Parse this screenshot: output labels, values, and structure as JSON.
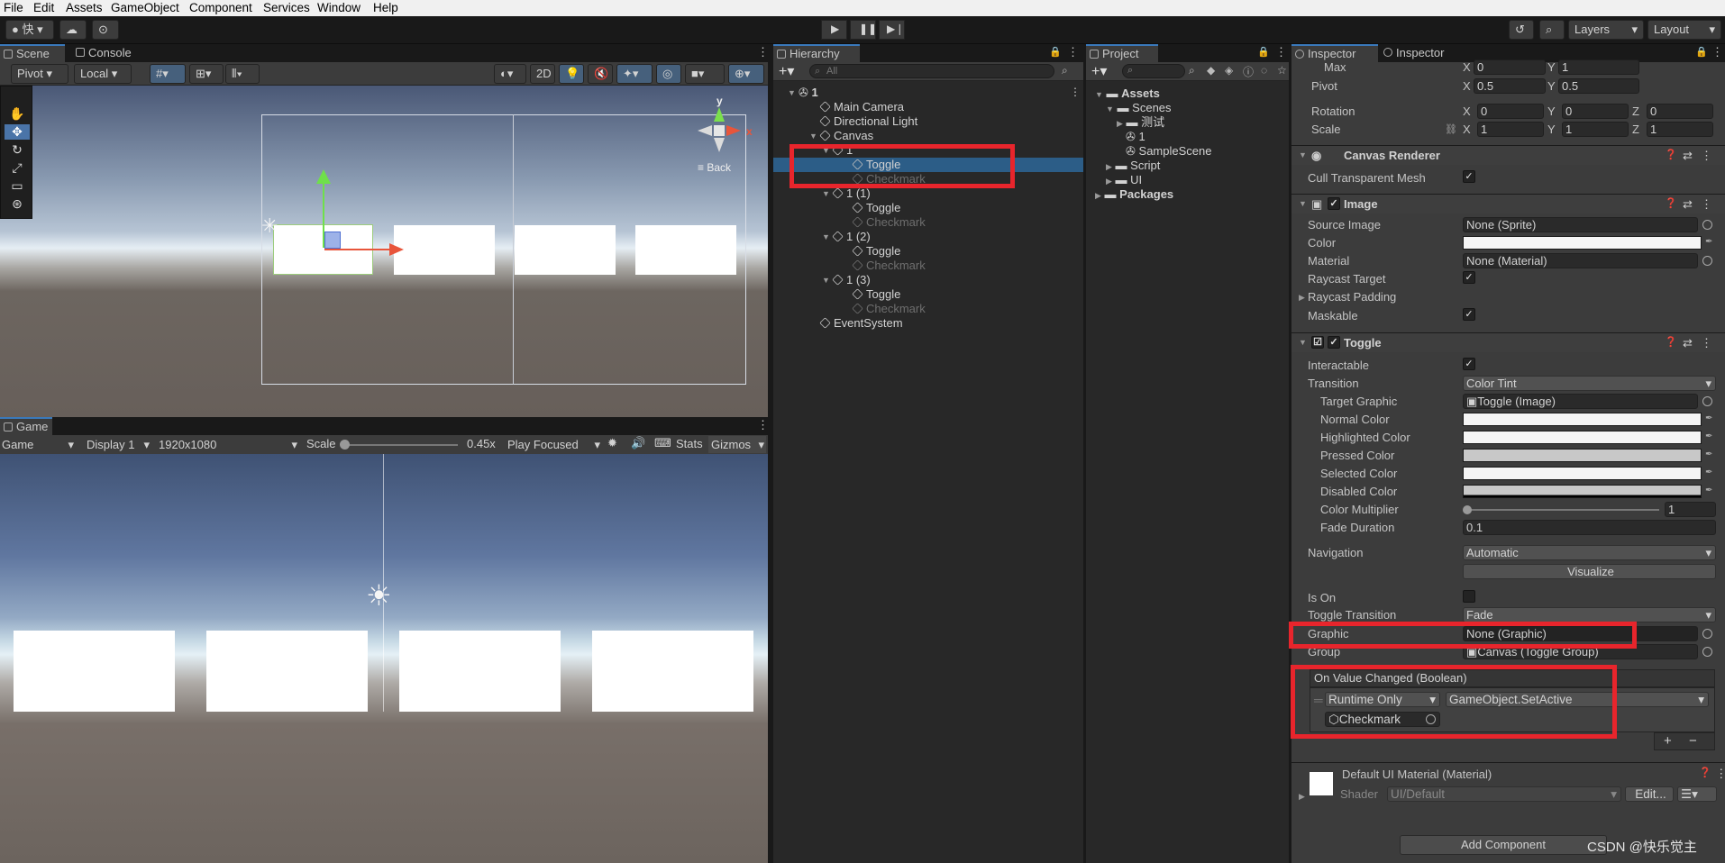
{
  "menubar": {
    "items": [
      "File",
      "Edit",
      "Assets",
      "GameObject",
      "Component",
      "Services",
      "Window",
      "Help"
    ]
  },
  "toolbar": {
    "account": "快",
    "layers": "Layers",
    "layout": "Layout"
  },
  "scene": {
    "tabs": [
      "Scene",
      "Console"
    ],
    "pivot": "Pivot",
    "local": "Local",
    "mode2d": "2D",
    "back_label": "Back",
    "gizmo_y": "y",
    "gizmo_x": "x"
  },
  "game": {
    "tab": "Game",
    "display_mode": "Game",
    "display": "Display 1",
    "resolution": "1920x1080",
    "scale_label": "Scale",
    "scale_value": "0.45x",
    "play_mode": "Play Focused",
    "stats": "Stats",
    "gizmos": "Gizmos"
  },
  "hierarchy": {
    "tab": "Hierarchy",
    "search_placeholder": "All",
    "rows": [
      {
        "label": "1"
      },
      {
        "label": "Main Camera"
      },
      {
        "label": "Directional Light"
      },
      {
        "label": "Canvas"
      },
      {
        "label": "1"
      },
      {
        "label": "Toggle"
      },
      {
        "label": "Checkmark"
      },
      {
        "label": "1 (1)"
      },
      {
        "label": "Toggle"
      },
      {
        "label": "Checkmark"
      },
      {
        "label": "1 (2)"
      },
      {
        "label": "Toggle"
      },
      {
        "label": "Checkmark"
      },
      {
        "label": "1 (3)"
      },
      {
        "label": "Toggle"
      },
      {
        "label": "Checkmark"
      },
      {
        "label": "EventSystem"
      }
    ]
  },
  "project": {
    "tab": "Project",
    "tree": [
      "Assets",
      "Scenes",
      "测试",
      "1",
      "SampleScene",
      "Script",
      "UI",
      "Packages"
    ]
  },
  "inspector": {
    "tabs": [
      "Inspector",
      "Inspector"
    ],
    "rect": {
      "max_label": "Max",
      "max_x": "0",
      "max_y": "1",
      "pivot_label": "Pivot",
      "pivot_x": "0.5",
      "pivot_y": "0.5",
      "rotation_label": "Rotation",
      "rot_x": "0",
      "rot_y": "0",
      "rot_z": "0",
      "scale_label": "Scale",
      "scale_x": "1",
      "scale_y": "1",
      "scale_z": "1",
      "x": "X",
      "y": "Y",
      "z": "Z"
    },
    "canvas_renderer": {
      "title": "Canvas Renderer",
      "cull_label": "Cull Transparent Mesh"
    },
    "image": {
      "title": "Image",
      "source_label": "Source Image",
      "source_value": "None (Sprite)",
      "color_label": "Color",
      "material_label": "Material",
      "material_value": "None (Material)",
      "raycast_target_label": "Raycast Target",
      "raycast_padding_label": "Raycast Padding",
      "maskable_label": "Maskable"
    },
    "toggle": {
      "title": "Toggle",
      "interactable_label": "Interactable",
      "transition_label": "Transition",
      "transition_value": "Color Tint",
      "target_graphic_label": "Target Graphic",
      "target_graphic_value": "Toggle (Image)",
      "normal_label": "Normal Color",
      "highlighted_label": "Highlighted Color",
      "pressed_label": "Pressed Color",
      "selected_label": "Selected Color",
      "disabled_label": "Disabled Color",
      "multiplier_label": "Color Multiplier",
      "multiplier_value": "1",
      "fade_label": "Fade Duration",
      "fade_value": "0.1",
      "navigation_label": "Navigation",
      "navigation_value": "Automatic",
      "visualize_label": "Visualize",
      "is_on_label": "Is On",
      "toggle_transition_label": "Toggle Transition",
      "toggle_transition_value": "Fade",
      "graphic_label": "Graphic",
      "graphic_value": "None (Graphic)",
      "group_label": "Group",
      "group_value": "Canvas (Toggle Group)",
      "event_title": "On Value Changed (Boolean)",
      "runtime_value": "Runtime Only",
      "function_value": "GameObject.SetActive",
      "object_value": "Checkmark",
      "plus": "+",
      "minus": "−"
    },
    "material": {
      "name": "Default UI Material (Material)",
      "shader_label": "Shader",
      "shader_value": "UI/Default",
      "edit_label": "Edit..."
    },
    "add_component": "Add Component"
  },
  "watermark": "CSDN @快乐觉主",
  "colors": {
    "highlight": "#e8252c",
    "selection": "#2c5d87",
    "accent": "#3a79bb"
  }
}
